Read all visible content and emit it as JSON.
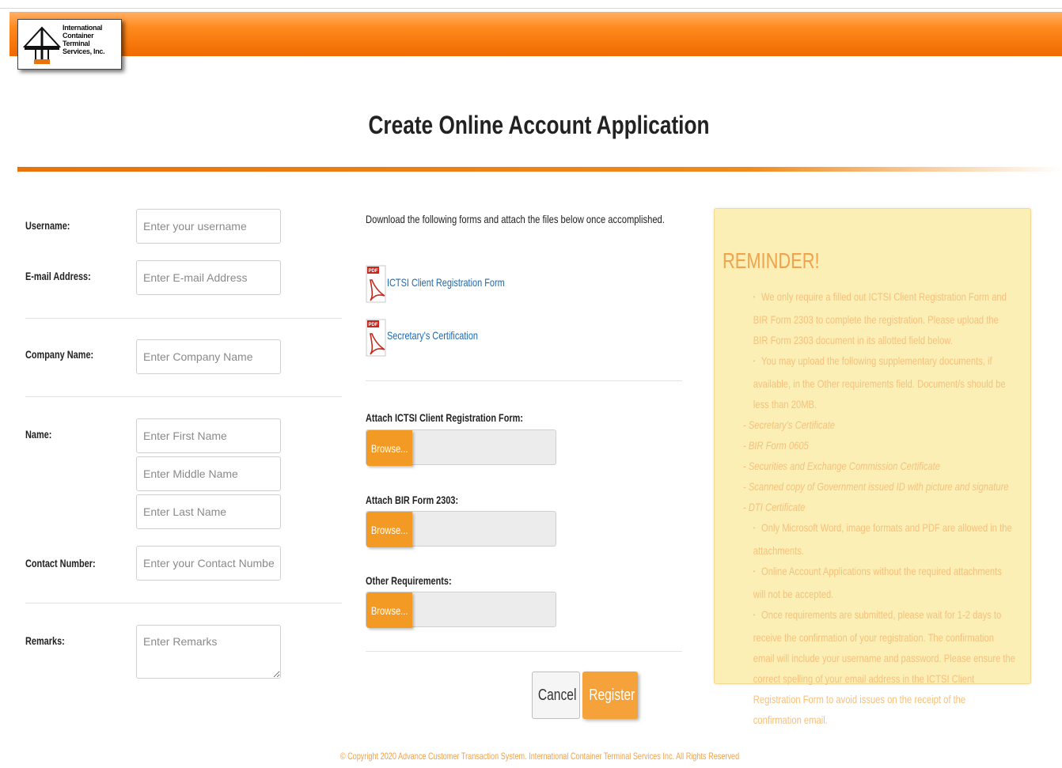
{
  "brand": {
    "logo_lines": [
      "International",
      "Container Terminal",
      "Services, Inc."
    ],
    "accent": "#f39a25",
    "banner_color": "#f06a00"
  },
  "page_title": "Create Online Account Application",
  "form": {
    "username": {
      "label": "Username:",
      "placeholder": "Enter your username"
    },
    "email": {
      "label": "E-mail Address:",
      "placeholder": "Enter E-mail Address"
    },
    "company": {
      "label": "Company Name:",
      "placeholder": "Enter Company Name"
    },
    "name": {
      "label": "Name:",
      "first_placeholder": "Enter First Name",
      "middle_placeholder": "Enter Middle Name",
      "last_placeholder": "Enter Last Name"
    },
    "contact": {
      "label": "Contact Number:",
      "placeholder": "Enter your Contact Number"
    },
    "remarks": {
      "label": "Remarks:",
      "placeholder": "Enter Remarks"
    }
  },
  "downloads": {
    "intro": "Download the following forms and attach the files below once accomplished.",
    "items": [
      {
        "label": "ICTSI Client Registration Form",
        "icon": "pdf-icon"
      },
      {
        "label": "Secretary's Certification",
        "icon": "pdf-icon"
      }
    ]
  },
  "attachments": [
    {
      "label": "Attach ICTSI Client Registration Form:",
      "button": "Browse..."
    },
    {
      "label": "Attach BIR Form 2303:",
      "button": "Browse..."
    },
    {
      "label": "Other Requirements:",
      "button": "Browse..."
    }
  ],
  "actions": {
    "cancel": "Cancel",
    "register": "Register"
  },
  "reminder": {
    "title": "REMINDER!",
    "p1": "We only require a filled out ICTSI Client Registration Form and BIR Form 2303 to complete the registration. Please upload the BIR Form 2303 document in its allotted field below.",
    "p2": "You may upload the following supplementary documents, if available, in the Other requirements field. Document/s should be less than 20MB.",
    "docs": [
      "- Secretary's Certificate",
      "- BIR Form 0605",
      "- Securities and Exchange Commission Certificate",
      "- Scanned copy of Government issued ID with picture and signature",
      "- DTI Certificate"
    ],
    "p3": "Only Microsoft Word, image formats and PDF are allowed in the attachments.",
    "p4": "Online Account Applications without the required attachments will not be accepted.",
    "p5": "Once requirements are submitted, please wait for 1-2 days to receive the confirmation of your registration. The confirmation email will include your username and password. Please ensure the correct spelling of your email address in the ICTSI Client Registration Form to avoid issues on the receipt of the confirmation email."
  },
  "footer": "© Copyright 2020 Advance Customer Transaction System. International Container Terminal Services Inc. All Rights Reserved"
}
